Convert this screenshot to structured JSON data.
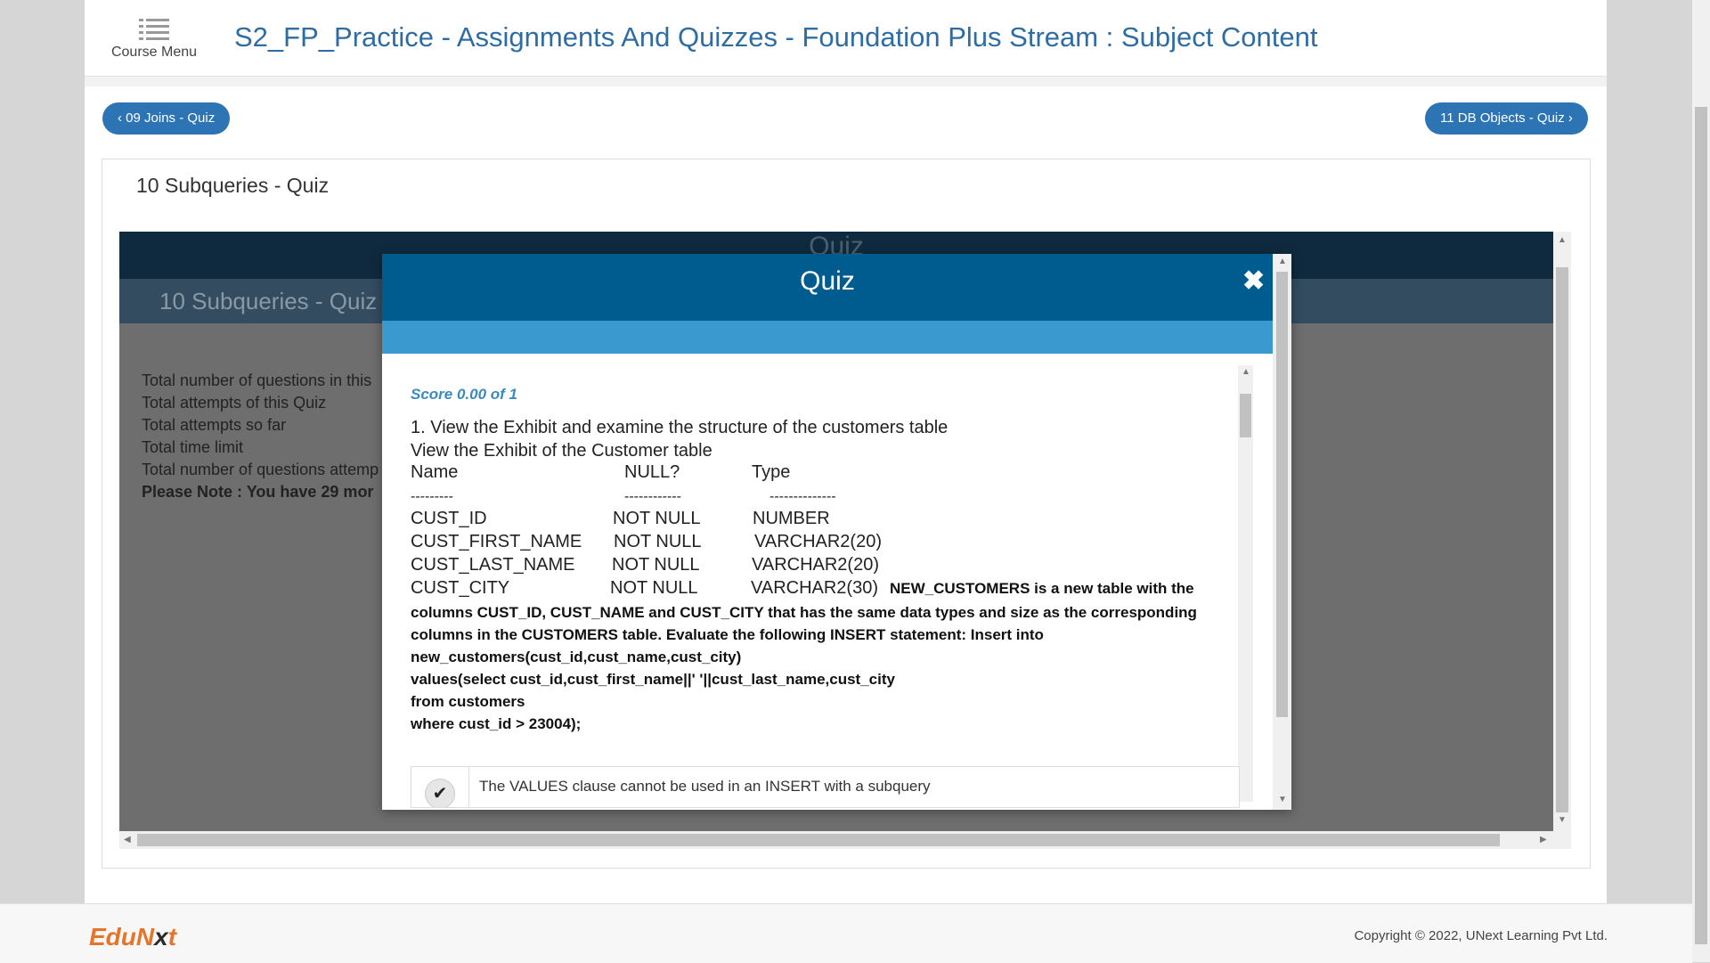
{
  "header": {
    "course_menu_label": "Course Menu",
    "title": "S2_FP_Practice - Assignments And Quizzes - Foundation Plus Stream : Subject Content"
  },
  "nav": {
    "prev_label": "‹ 09 Joins - Quiz",
    "next_label": "11 DB Objects - Quiz ›"
  },
  "panel": {
    "title": "10 Subqueries - Quiz"
  },
  "frame": {
    "top_title": "Quiz",
    "band_title": "10 Subqueries - Quiz",
    "info_lines": [
      "Total number of questions in this",
      "Total attempts of this Quiz",
      "Total attempts so far",
      "Total time limit",
      "Total number of questions attemp"
    ],
    "note": "Please Note : You have 29 mor"
  },
  "modal": {
    "title": "Quiz",
    "close_glyph": "✖",
    "score": "Score 0.00 of 1",
    "question_line1": "1. View the Exhibit and examine the structure of the customers table",
    "question_line2": "View the Exhibit of the Customer table",
    "table_header": [
      "Name",
      "NULL?",
      "Type"
    ],
    "table_dashes": [
      "---------",
      "------------",
      "--------------"
    ],
    "table_rows": [
      [
        "CUST_ID",
        "NOT NULL",
        "NUMBER"
      ],
      [
        "CUST_FIRST_NAME",
        "NOT NULL",
        "VARCHAR2(20)"
      ],
      [
        "CUST_LAST_NAME",
        "NOT NULL",
        "VARCHAR2(20)"
      ],
      [
        "CUST_CITY",
        "NOT NULL",
        "VARCHAR2(30)"
      ]
    ],
    "bold_inline": "NEW_CUSTOMERS is a new table with the",
    "bold_lines": [
      "columns CUST_ID, CUST_NAME and CUST_CITY that has the same data types and size as the corresponding",
      "columns in the CUSTOMERS table. Evaluate the following INSERT statement: Insert into",
      "new_customers(cust_id,cust_name,cust_city)",
      "values(select cust_id,cust_first_name||' '||cust_last_name,cust_city",
      "from customers",
      "where cust_id > 23004);"
    ],
    "option_text": "The VALUES clause cannot be used in an INSERT with a subquery",
    "option_check": "✔"
  },
  "footer": {
    "logo_part1": "EduN",
    "logo_x": "x",
    "logo_part2": "t",
    "copyright": "Copyright © 2022, UNext Learning Pvt Ltd."
  },
  "colors": {
    "primary": "#2c74b3",
    "modal_header": "#005b8e",
    "modal_band": "#3a9ad0",
    "logo_orange": "#e3762b"
  },
  "icons": {
    "course_menu": "list-menu-icon",
    "close": "close-icon",
    "option_check": "check-icon"
  }
}
